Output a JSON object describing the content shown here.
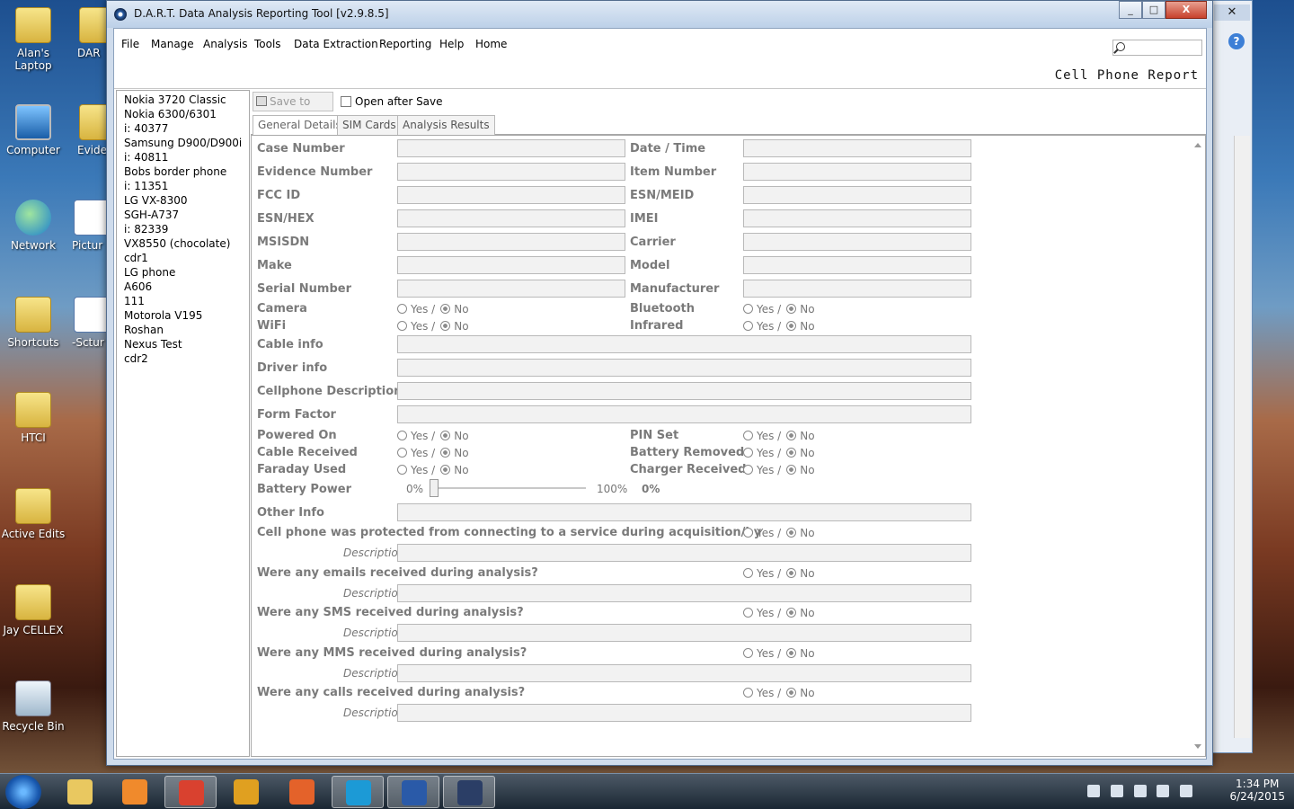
{
  "desktop": {
    "icons": [
      {
        "label": "Alan's Laptop",
        "kind": "folder-user-icon"
      },
      {
        "label": "Computer",
        "kind": "computer-icon"
      },
      {
        "label": "Network",
        "kind": "network-icon"
      },
      {
        "label": "Shortcuts",
        "kind": "folder-icon"
      },
      {
        "label": "HTCI",
        "kind": "folder-icon"
      },
      {
        "label": "Active Edits",
        "kind": "folder-icon"
      },
      {
        "label": "Jay CELLEX",
        "kind": "folder-icon"
      },
      {
        "label": "Recycle Bin",
        "kind": "recycle-bin-icon"
      }
    ],
    "partial_icons": [
      "DAR",
      "Evide",
      "Pictur and fo",
      "-Sctur and fo"
    ]
  },
  "window": {
    "title": "D.A.R.T. Data Analysis Reporting Tool [v2.9.8.5]",
    "report_title": "Cell Phone Report",
    "buttons": {
      "minimize": "_",
      "maximize": "□",
      "close": "X"
    }
  },
  "menu": [
    "File",
    "Manage",
    "Analysis",
    "Tools",
    "Data Extraction",
    "Reporting",
    "Help",
    "Home"
  ],
  "search": {
    "placeholder": ""
  },
  "devices": [
    "Nokia 3720 Classic",
    "Nokia 6300/6301",
    "i: 40377",
    "Samsung D900/D900i",
    "i: 40811",
    "Bobs border phone",
    "i: 11351",
    "LG VX-8300",
    "SGH-A737",
    "i: 82339",
    "VX8550 (chocolate)",
    "cdr1",
    "LG phone",
    "A606",
    "111",
    "Motorola V195",
    "Roshan",
    "Nexus Test",
    "cdr2"
  ],
  "toolbar": {
    "save_pdf": "Save to PDF",
    "open_after_save": "Open after Save"
  },
  "tabs": [
    "General Details",
    "SIM Cards",
    "Analysis Results"
  ],
  "radio": {
    "yes": "Yes /",
    "no": "No"
  },
  "form": {
    "text_pairs": [
      {
        "left": "Case Number",
        "right": "Date / Time"
      },
      {
        "left": "Evidence Number",
        "right": "Item Number"
      },
      {
        "left": "FCC ID",
        "right": "ESN/MEID"
      },
      {
        "left": "ESN/HEX",
        "right": "IMEI"
      },
      {
        "left": "MSISDN",
        "right": "Carrier"
      },
      {
        "left": "Make",
        "right": "Model"
      },
      {
        "left": "Serial Number",
        "right": "Manufacturer"
      }
    ],
    "radio_pairs_1": [
      {
        "left": "Camera",
        "right": "Bluetooth"
      },
      {
        "left": "WiFi",
        "right": "Infrared"
      }
    ],
    "wide_fields": [
      "Cable info",
      "Driver info",
      "Cellphone Description",
      "Form Factor"
    ],
    "radio_pairs_2": [
      {
        "left": "Powered On",
        "right": "PIN Set"
      },
      {
        "left": "Cable Received",
        "right": "Battery Removed"
      },
      {
        "left": "Faraday Used",
        "right": "Charger Received"
      }
    ],
    "battery": {
      "label": "Battery Power",
      "min": "0%",
      "max": "100%",
      "value_text": "0%",
      "value": 0
    },
    "other_info": "Other Info",
    "description_label": "Description",
    "questions": [
      "Cell phone was protected from connecting to a service during acquisition/by",
      "Were any emails received during analysis?",
      "Were any SMS received during analysis?",
      "Were any MMS received during analysis?",
      "Were any calls received during analysis?"
    ]
  },
  "taskbar": {
    "apps": [
      "explorer-icon",
      "media-player-icon",
      "chrome-icon",
      "apps-icon",
      "firefox-icon",
      "skype-icon",
      "word-icon",
      "dart-icon"
    ],
    "time": "1:34 PM",
    "date": "6/24/2015"
  },
  "colors": {
    "label_gray": "#7a7a7a",
    "field_bg": "#f2f2f2",
    "window_frame": "#cfdcec"
  }
}
